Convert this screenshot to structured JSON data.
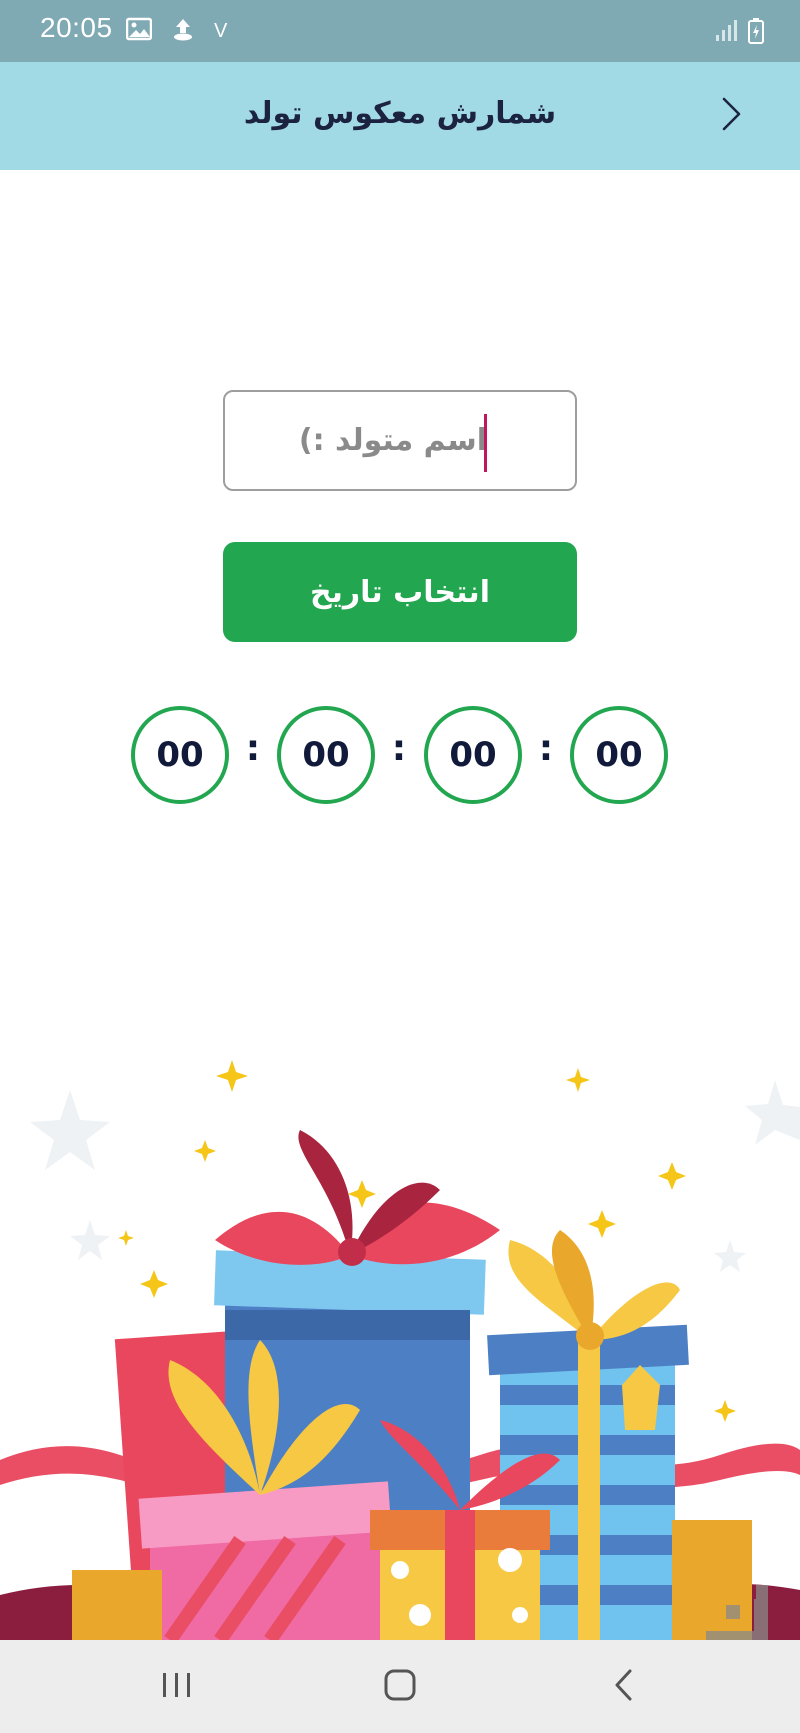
{
  "status_bar": {
    "time": "20:05",
    "notification_char": "V",
    "icons": [
      "image-icon",
      "upload-icon",
      "signal-icon",
      "battery-charging-icon"
    ]
  },
  "app_bar": {
    "title": "شمارش معکوس تولد",
    "back_icon": "chevron-right-icon"
  },
  "name_input": {
    "placeholder": "اسم متولد :)",
    "value": ""
  },
  "pick_date_button": {
    "label": "انتخاب تاریخ"
  },
  "countdown": {
    "units": [
      "00",
      "00",
      "00",
      "00"
    ],
    "separator": ":"
  },
  "nav_bar": {
    "icons": [
      "recent-apps-icon",
      "home-icon",
      "back-icon"
    ]
  },
  "colors": {
    "status_bar": "#7fa9b3",
    "app_bar": "#a1d9e4",
    "primary_green": "#22a64f",
    "title_text": "#1b2340"
  }
}
